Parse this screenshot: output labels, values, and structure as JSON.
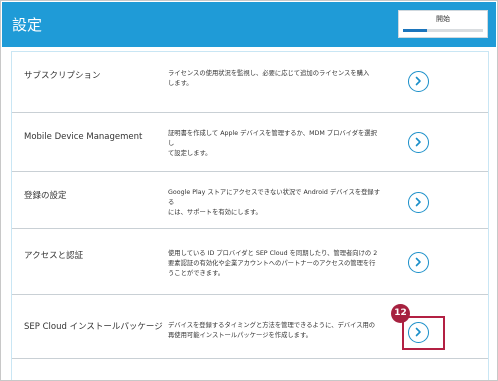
{
  "header": {
    "title": "設定",
    "progress_label": "開始",
    "progress_fraction": 0.3,
    "accent_color": "#1f9bd7"
  },
  "rows": [
    {
      "label": "サブスクリプション",
      "desc_lines": [
        "ライセンスの使用状況を監視し、必要に応じて追加のライセンスを購入",
        "します。"
      ]
    },
    {
      "label": "Mobile Device Management",
      "desc_lines": [
        "証明書を作成して Apple デバイスを管理するか、MDM プロバイダを選択し",
        "て設定します。"
      ]
    },
    {
      "label": "登録の設定",
      "desc_lines": [
        "Google Play ストアにアクセスできない状況で Android デバイスを登録する",
        "には、サポートを有効にします。"
      ]
    },
    {
      "label": "アクセスと認証",
      "desc_lines": [
        "使用している ID プロバイダと SEP Cloud を同期したり、管理者向けの 2",
        "要素認証の有効化や企業アカウントへのパートナーのアクセスの管理を行",
        "うことができます。"
      ]
    },
    {
      "label": "SEP Cloud インストールパッケージ",
      "desc_lines": [
        "デバイスを登録するタイミングと方法を管理できるように、デバイス用の",
        "再使用可能インストールパッケージを作成します。"
      ]
    }
  ],
  "annotation": {
    "badge_number": "12",
    "highlight_color": "#b32043"
  },
  "icons": {
    "nav_button": "chevron-right-icon"
  }
}
